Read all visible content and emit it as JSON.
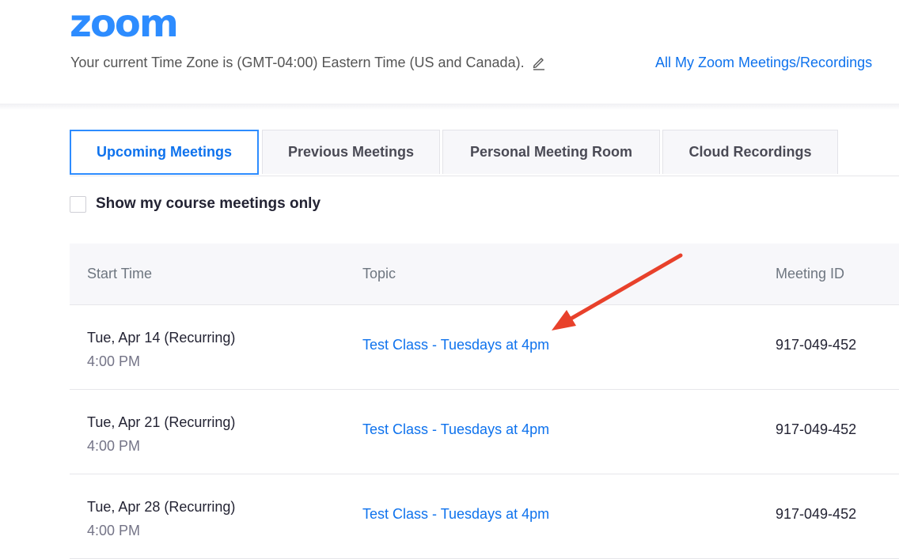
{
  "header": {
    "logo_text": "zoom",
    "timezone_text": "Your current Time Zone is (GMT-04:00) Eastern Time (US and Canada).",
    "all_meetings_link": "All My Zoom Meetings/Recordings",
    "edit_icon": "pencil-icon"
  },
  "tabs": [
    {
      "label": "Upcoming Meetings",
      "active": true
    },
    {
      "label": "Previous Meetings",
      "active": false
    },
    {
      "label": "Personal Meeting Room",
      "active": false
    },
    {
      "label": "Cloud Recordings",
      "active": false
    }
  ],
  "filter": {
    "checkbox_label": "Show my course meetings only",
    "checked": false
  },
  "table": {
    "headers": {
      "start_time": "Start Time",
      "topic": "Topic",
      "meeting_id": "Meeting ID"
    },
    "rows": [
      {
        "date": "Tue, Apr 14 (Recurring)",
        "time": "4:00 PM",
        "topic": "Test Class - Tuesdays at 4pm",
        "meeting_id": "917-049-452"
      },
      {
        "date": "Tue, Apr 21 (Recurring)",
        "time": "4:00 PM",
        "topic": "Test Class - Tuesdays at 4pm",
        "meeting_id": "917-049-452"
      },
      {
        "date": "Tue, Apr 28 (Recurring)",
        "time": "4:00 PM",
        "topic": "Test Class - Tuesdays at 4pm",
        "meeting_id": "917-049-452"
      }
    ]
  },
  "colors": {
    "brand_blue": "#2D8CFF",
    "link_blue": "#0E72ED",
    "annotation_arrow": "#E8412B"
  }
}
